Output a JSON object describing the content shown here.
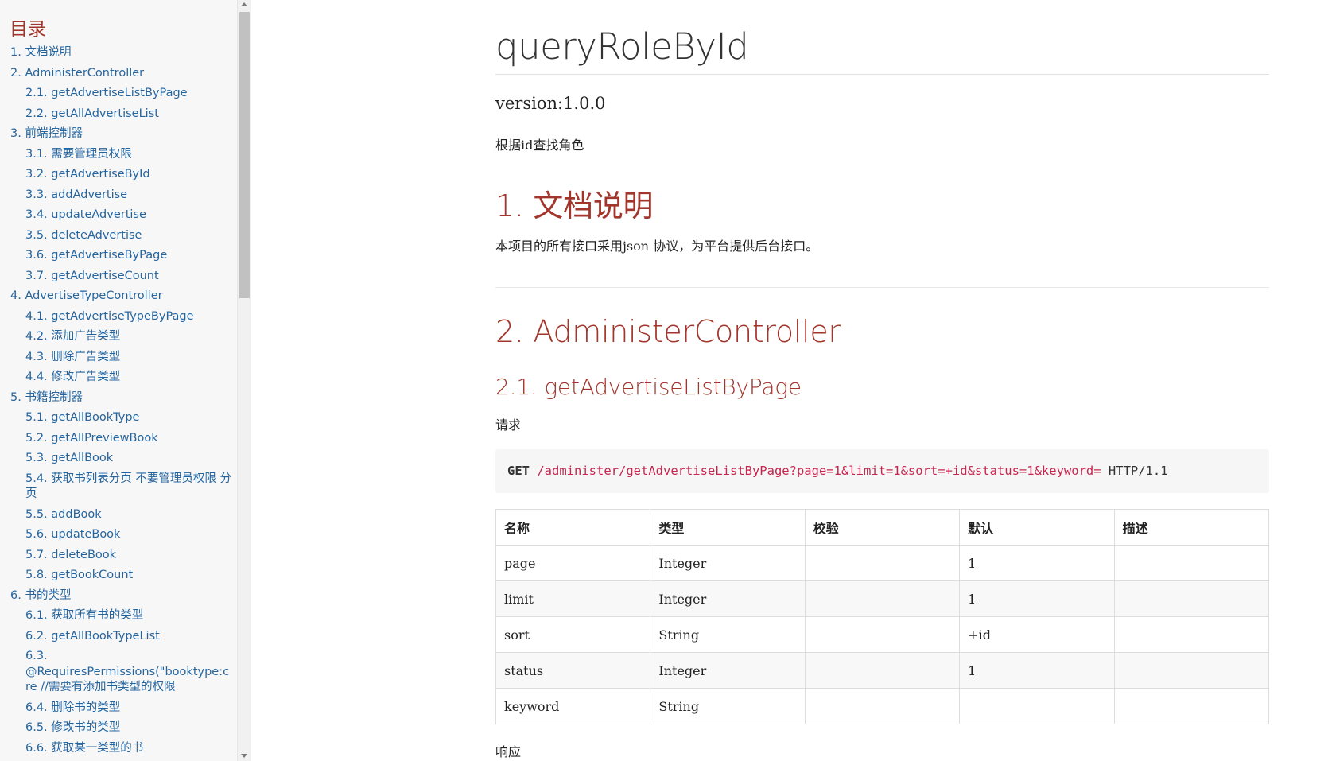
{
  "toc": {
    "title": "目录",
    "items": [
      {
        "label": "1. 文档说明",
        "level": 1
      },
      {
        "label": "2. AdministerController",
        "level": 1
      },
      {
        "label": "2.1. getAdvertiseListByPage",
        "level": 2
      },
      {
        "label": "2.2. getAllAdvertiseList",
        "level": 2
      },
      {
        "label": "3. 前端控制器",
        "level": 1
      },
      {
        "label": "3.1. 需要管理员权限",
        "level": 2
      },
      {
        "label": "3.2. getAdvertiseById",
        "level": 2
      },
      {
        "label": "3.3. addAdvertise",
        "level": 2
      },
      {
        "label": "3.4. updateAdvertise",
        "level": 2
      },
      {
        "label": "3.5. deleteAdvertise",
        "level": 2
      },
      {
        "label": "3.6. getAdvertiseByPage",
        "level": 2
      },
      {
        "label": "3.7. getAdvertiseCount",
        "level": 2
      },
      {
        "label": "4. AdvertiseTypeController",
        "level": 1
      },
      {
        "label": "4.1. getAdvertiseTypeByPage",
        "level": 2
      },
      {
        "label": "4.2. 添加广告类型",
        "level": 2
      },
      {
        "label": "4.3. 删除广告类型",
        "level": 2
      },
      {
        "label": "4.4. 修改广告类型",
        "level": 2
      },
      {
        "label": "5. 书籍控制器",
        "level": 1
      },
      {
        "label": "5.1. getAllBookType",
        "level": 2
      },
      {
        "label": "5.2. getAllPreviewBook",
        "level": 2
      },
      {
        "label": "5.3. getAllBook",
        "level": 2
      },
      {
        "label": "5.4. 获取书列表分页 不要管理员权限 分页",
        "level": 2
      },
      {
        "label": "5.5. addBook",
        "level": 2
      },
      {
        "label": "5.6. updateBook",
        "level": 2
      },
      {
        "label": "5.7. deleteBook",
        "level": 2
      },
      {
        "label": "5.8. getBookCount",
        "level": 2
      },
      {
        "label": "6. 书的类型",
        "level": 1
      },
      {
        "label": "6.1. 获取所有书的类型",
        "level": 2
      },
      {
        "label": "6.2. getAllBookTypeList",
        "level": 2
      },
      {
        "label": "6.3. @RequiresPermissions(\"booktype:cre //需要有添加书类型的权限",
        "level": 2
      },
      {
        "label": "6.4. 删除书的类型",
        "level": 2
      },
      {
        "label": "6.5. 修改书的类型",
        "level": 2
      },
      {
        "label": "6.6. 获取某一类型的书",
        "level": 2
      }
    ]
  },
  "doc": {
    "title": "queryRoleById",
    "version": "version:1.0.0",
    "description": "根据id查找角色"
  },
  "sections": {
    "doc_heading": "1. 文档说明",
    "doc_text": "本项目的所有接口采用json 协议，为平台提供后台接口。",
    "admin_heading": "2. AdministerController",
    "sub_heading": "2.1. getAdvertiseListByPage",
    "request_label": "请求",
    "response_label": "响应"
  },
  "request": {
    "method": "GET",
    "url": "/administer/getAdvertiseListByPage?page=1&limit=1&sort=+id&status=1&keyword=",
    "version": "HTTP/1.1"
  },
  "params_table": {
    "headers": [
      "名称",
      "类型",
      "校验",
      "默认",
      "描述"
    ],
    "rows": [
      [
        "page",
        "Integer",
        "",
        "1",
        ""
      ],
      [
        "limit",
        "Integer",
        "",
        "1",
        ""
      ],
      [
        "sort",
        "String",
        "",
        "+id",
        ""
      ],
      [
        "status",
        "Integer",
        "",
        "1",
        ""
      ],
      [
        "keyword",
        "String",
        "",
        "",
        ""
      ]
    ]
  },
  "colors": {
    "heading": "#a2362c",
    "link": "#25659f",
    "code_url": "#c7254e"
  }
}
